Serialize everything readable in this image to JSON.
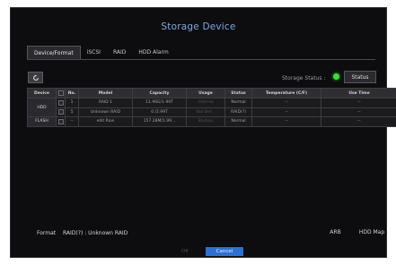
{
  "dialog": {
    "title": "Storage Device"
  },
  "tabs": [
    {
      "label": "Device/Format",
      "active": true
    },
    {
      "label": "iSCSI",
      "active": false
    },
    {
      "label": "RAID",
      "active": false
    },
    {
      "label": "HDD Alarm",
      "active": false
    }
  ],
  "toolbar": {
    "refresh_icon": "refresh-icon",
    "storage_status_label": "Storage Status :",
    "status_indicator_color": "#3ddb38",
    "status_button": "Status"
  },
  "table": {
    "headers": [
      "Device",
      "No.",
      "Model",
      "Capacity",
      "Usage",
      "Status",
      "Temperature (C/F)",
      "Use Time"
    ],
    "rows": [
      {
        "device": "HDD",
        "no": "1",
        "model": "RAID 1",
        "capacity": "11.96G/1.99T",
        "usage": "Internal",
        "status": "Normal",
        "temperature": "--",
        "use_time": "--"
      },
      {
        "device": "",
        "no": "5",
        "model": "Unknown RAID",
        "capacity": "0 /2.99T",
        "usage": "Not Def...",
        "status": "RAID(?)",
        "temperature": "--",
        "use_time": "--"
      },
      {
        "device": "FLASH",
        "no": "--",
        "model": "edit Ravi",
        "capacity": "157.28M/1.99...",
        "usage": "Backup",
        "status": "Normal",
        "temperature": "--",
        "use_time": "--"
      }
    ]
  },
  "footer": {
    "format_button": "Format",
    "raid_info": "RAID(?) : Unknown RAID",
    "arb_button": "ARB",
    "hdd_map_button": "HDD Map",
    "ok_button": "OK",
    "cancel_button": "Cancel",
    "accent_color": "#2f6fd1"
  }
}
